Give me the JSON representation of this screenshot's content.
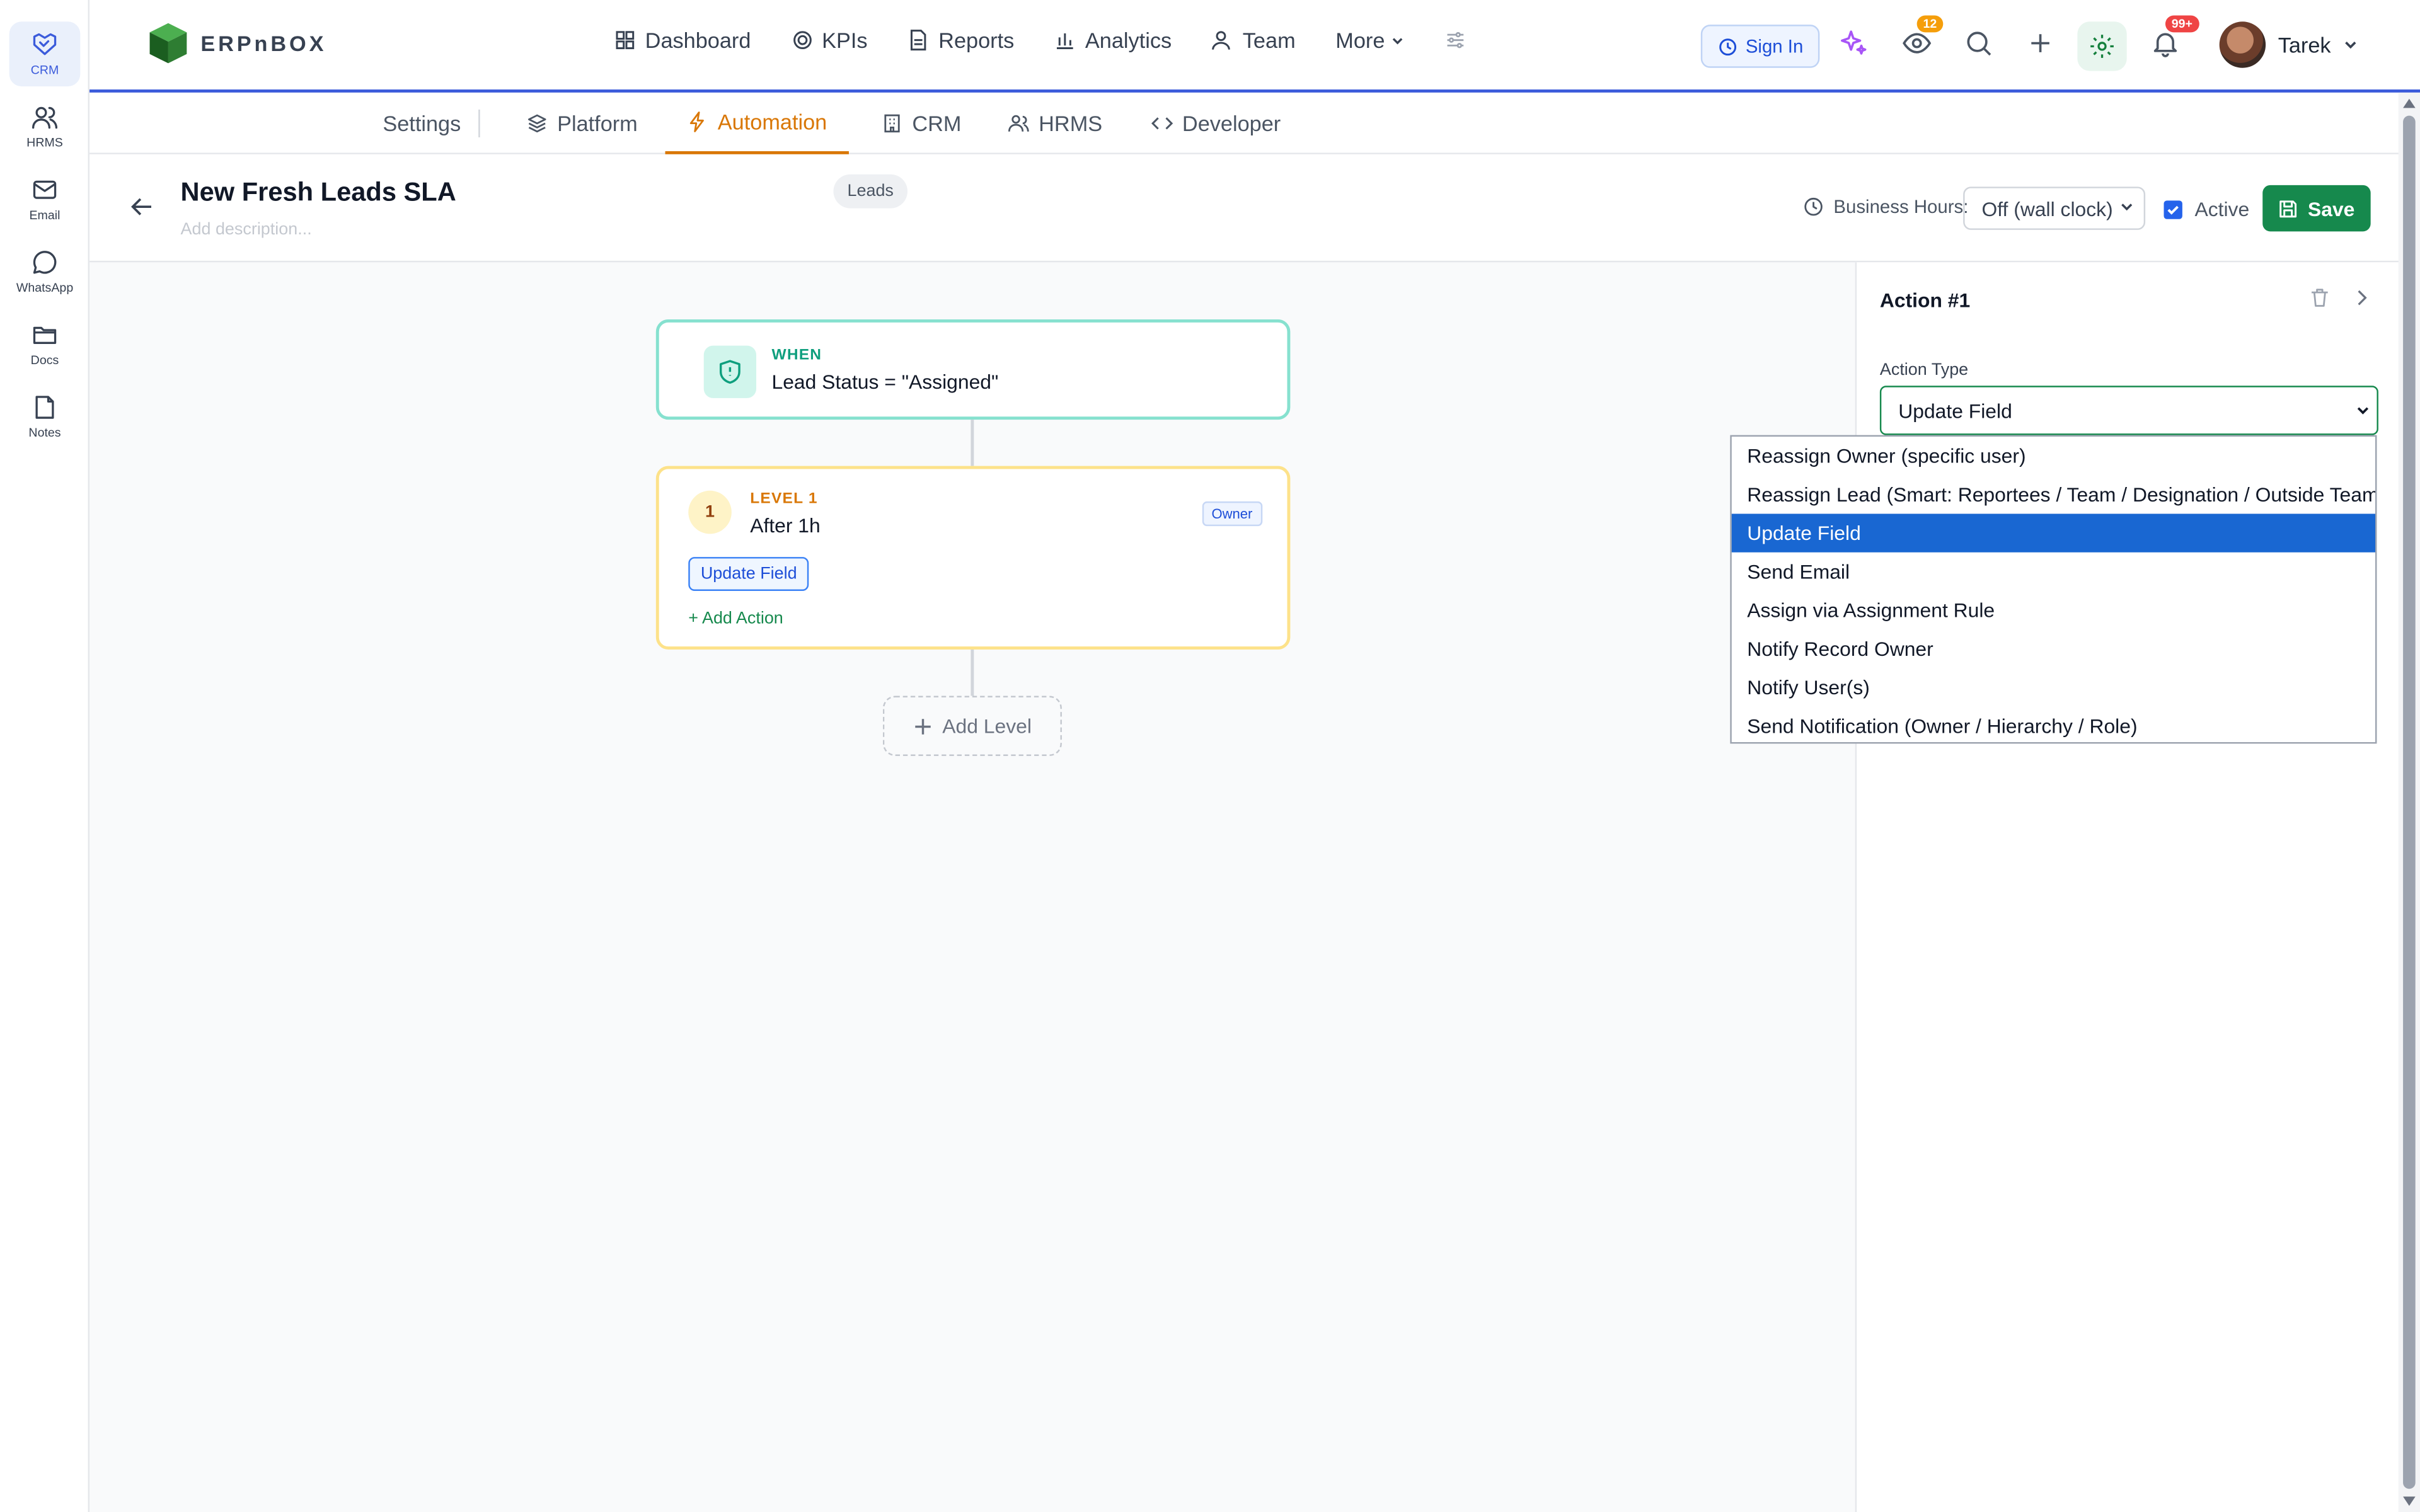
{
  "rail": [
    {
      "label": "CRM",
      "icon": "handshake-icon"
    },
    {
      "label": "HRMS",
      "icon": "users-icon"
    },
    {
      "label": "Email",
      "icon": "mail-icon"
    },
    {
      "label": "WhatsApp",
      "icon": "chat-icon"
    },
    {
      "label": "Docs",
      "icon": "folder-icon"
    },
    {
      "label": "Notes",
      "icon": "note-icon"
    }
  ],
  "brand": {
    "wordmark": "ERPnBOX"
  },
  "topnav": {
    "dashboard": "Dashboard",
    "kpis": "KPIs",
    "reports": "Reports",
    "analytics": "Analytics",
    "team": "Team",
    "more": "More"
  },
  "header": {
    "sign_in": "Sign In",
    "eye_badge": "12",
    "bell_badge": "99+",
    "user_name": "Tarek"
  },
  "tabs": {
    "settings": "Settings",
    "platform": "Platform",
    "automation": "Automation",
    "crm": "CRM",
    "hrms": "HRMS",
    "developer": "Developer"
  },
  "editor": {
    "title": "New Fresh Leads SLA",
    "description_placeholder": "Add description...",
    "module_pill": "Leads",
    "business_hours_label": "Business Hours:",
    "business_hours_value": "Off (wall clock)",
    "active_label": "Active",
    "save": "Save"
  },
  "flow": {
    "when_label": "WHEN",
    "when_condition": "Lead Status = \"Assigned\"",
    "level_number": "1",
    "level_label": "LEVEL 1",
    "level_after": "After 1h",
    "level_tag": "Owner",
    "action_chip": "Update Field",
    "add_action": "+ Add Action",
    "add_level": "Add Level"
  },
  "panel": {
    "title": "Action #1",
    "action_type_label": "Action Type",
    "action_type_value": "Update Field"
  },
  "dropdown": {
    "options": [
      "Reassign Owner (specific user)",
      "Reassign Lead (Smart: Reportees / Team / Designation / Outside Team)",
      "Update Field",
      "Send Email",
      "Assign via Assignment Rule",
      "Notify Record Owner",
      "Notify User(s)",
      "Send Notification (Owner / Hierarchy / Role)"
    ],
    "selected": "Update Field"
  },
  "colors": {
    "accent_green": "#16894d",
    "automation_orange": "#d97706",
    "when_teal": "#0f9f7e",
    "selection_blue": "#1967d2"
  }
}
